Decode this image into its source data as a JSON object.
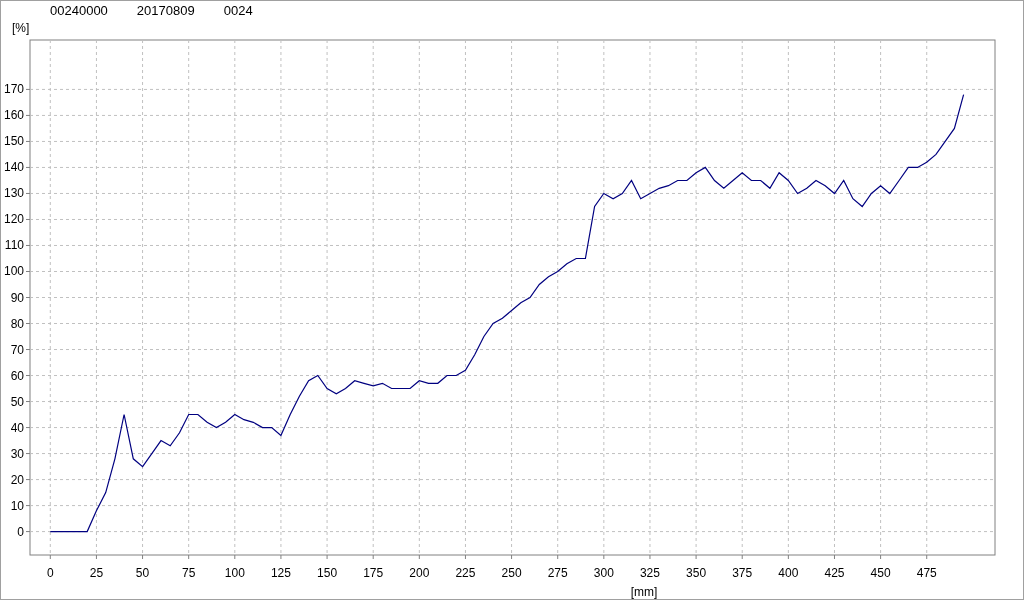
{
  "header": [
    "00240000",
    "20170809",
    "0024"
  ],
  "chart_data": {
    "type": "line",
    "grid": true,
    "xlabel": "[mm]",
    "ylabel": "[%]",
    "xlim": [
      -11,
      512
    ],
    "ylim": [
      -9,
      189
    ],
    "xticks": [
      0,
      25,
      50,
      75,
      100,
      125,
      150,
      175,
      200,
      225,
      250,
      275,
      300,
      325,
      350,
      375,
      400,
      425,
      450,
      475
    ],
    "yticks": [
      0,
      10,
      20,
      30,
      40,
      50,
      60,
      70,
      80,
      90,
      100,
      110,
      120,
      130,
      140,
      150,
      160,
      170
    ],
    "x": [
      0,
      5,
      10,
      15,
      20,
      25,
      30,
      35,
      40,
      45,
      50,
      55,
      60,
      65,
      70,
      75,
      80,
      85,
      90,
      95,
      100,
      105,
      110,
      115,
      120,
      125,
      130,
      135,
      140,
      145,
      150,
      155,
      160,
      165,
      170,
      175,
      180,
      185,
      190,
      195,
      200,
      205,
      210,
      215,
      220,
      225,
      230,
      235,
      240,
      245,
      250,
      255,
      260,
      265,
      270,
      275,
      280,
      285,
      290,
      295,
      300,
      305,
      310,
      315,
      320,
      325,
      330,
      335,
      340,
      345,
      350,
      355,
      360,
      365,
      370,
      375,
      380,
      385,
      390,
      395,
      400,
      405,
      410,
      415,
      420,
      425,
      430,
      435,
      440,
      445,
      450,
      455,
      460,
      465,
      470,
      475,
      480,
      485,
      490,
      495
    ],
    "series": [
      {
        "color": "#000080",
        "values": [
          0,
          0,
          0,
          0,
          0,
          8,
          15,
          28,
          45,
          28,
          25,
          30,
          35,
          33,
          38,
          45,
          45,
          42,
          40,
          42,
          45,
          43,
          42,
          40,
          40,
          37,
          45,
          52,
          58,
          60,
          55,
          53,
          55,
          58,
          57,
          56,
          57,
          55,
          55,
          55,
          58,
          57,
          57,
          60,
          60,
          62,
          68,
          75,
          80,
          82,
          85,
          88,
          90,
          95,
          98,
          100,
          103,
          105,
          105,
          125,
          130,
          128,
          130,
          135,
          128,
          130,
          132,
          133,
          135,
          135,
          138,
          140,
          135,
          132,
          135,
          138,
          135,
          135,
          132,
          138,
          135,
          130,
          132,
          135,
          133,
          130,
          135,
          128,
          125,
          130,
          133,
          130,
          135,
          140,
          140,
          142,
          145,
          150,
          155,
          168
        ]
      }
    ]
  }
}
